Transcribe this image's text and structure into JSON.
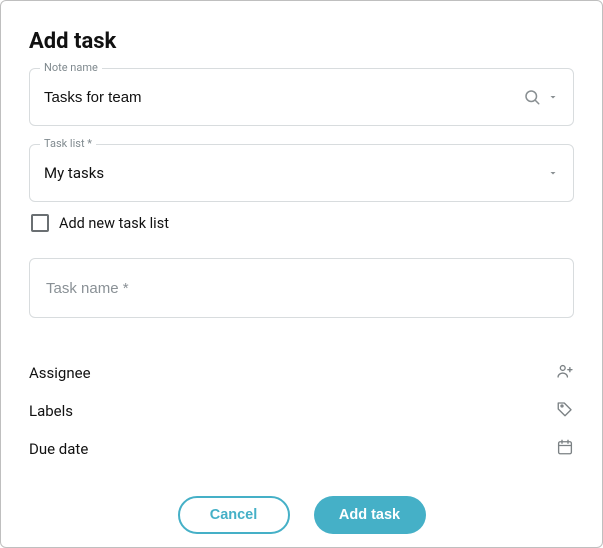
{
  "dialog": {
    "title": "Add task"
  },
  "noteName": {
    "label": "Note name",
    "value": "Tasks for team"
  },
  "taskList": {
    "label": "Task list *",
    "value": "My tasks"
  },
  "addNewList": {
    "label": "Add new task list",
    "checked": false
  },
  "taskName": {
    "placeholder": "Task name *",
    "value": ""
  },
  "meta": {
    "assignee": {
      "label": "Assignee"
    },
    "labels": {
      "label": "Labels"
    },
    "dueDate": {
      "label": "Due date"
    }
  },
  "actions": {
    "cancel": "Cancel",
    "submit": "Add task"
  }
}
